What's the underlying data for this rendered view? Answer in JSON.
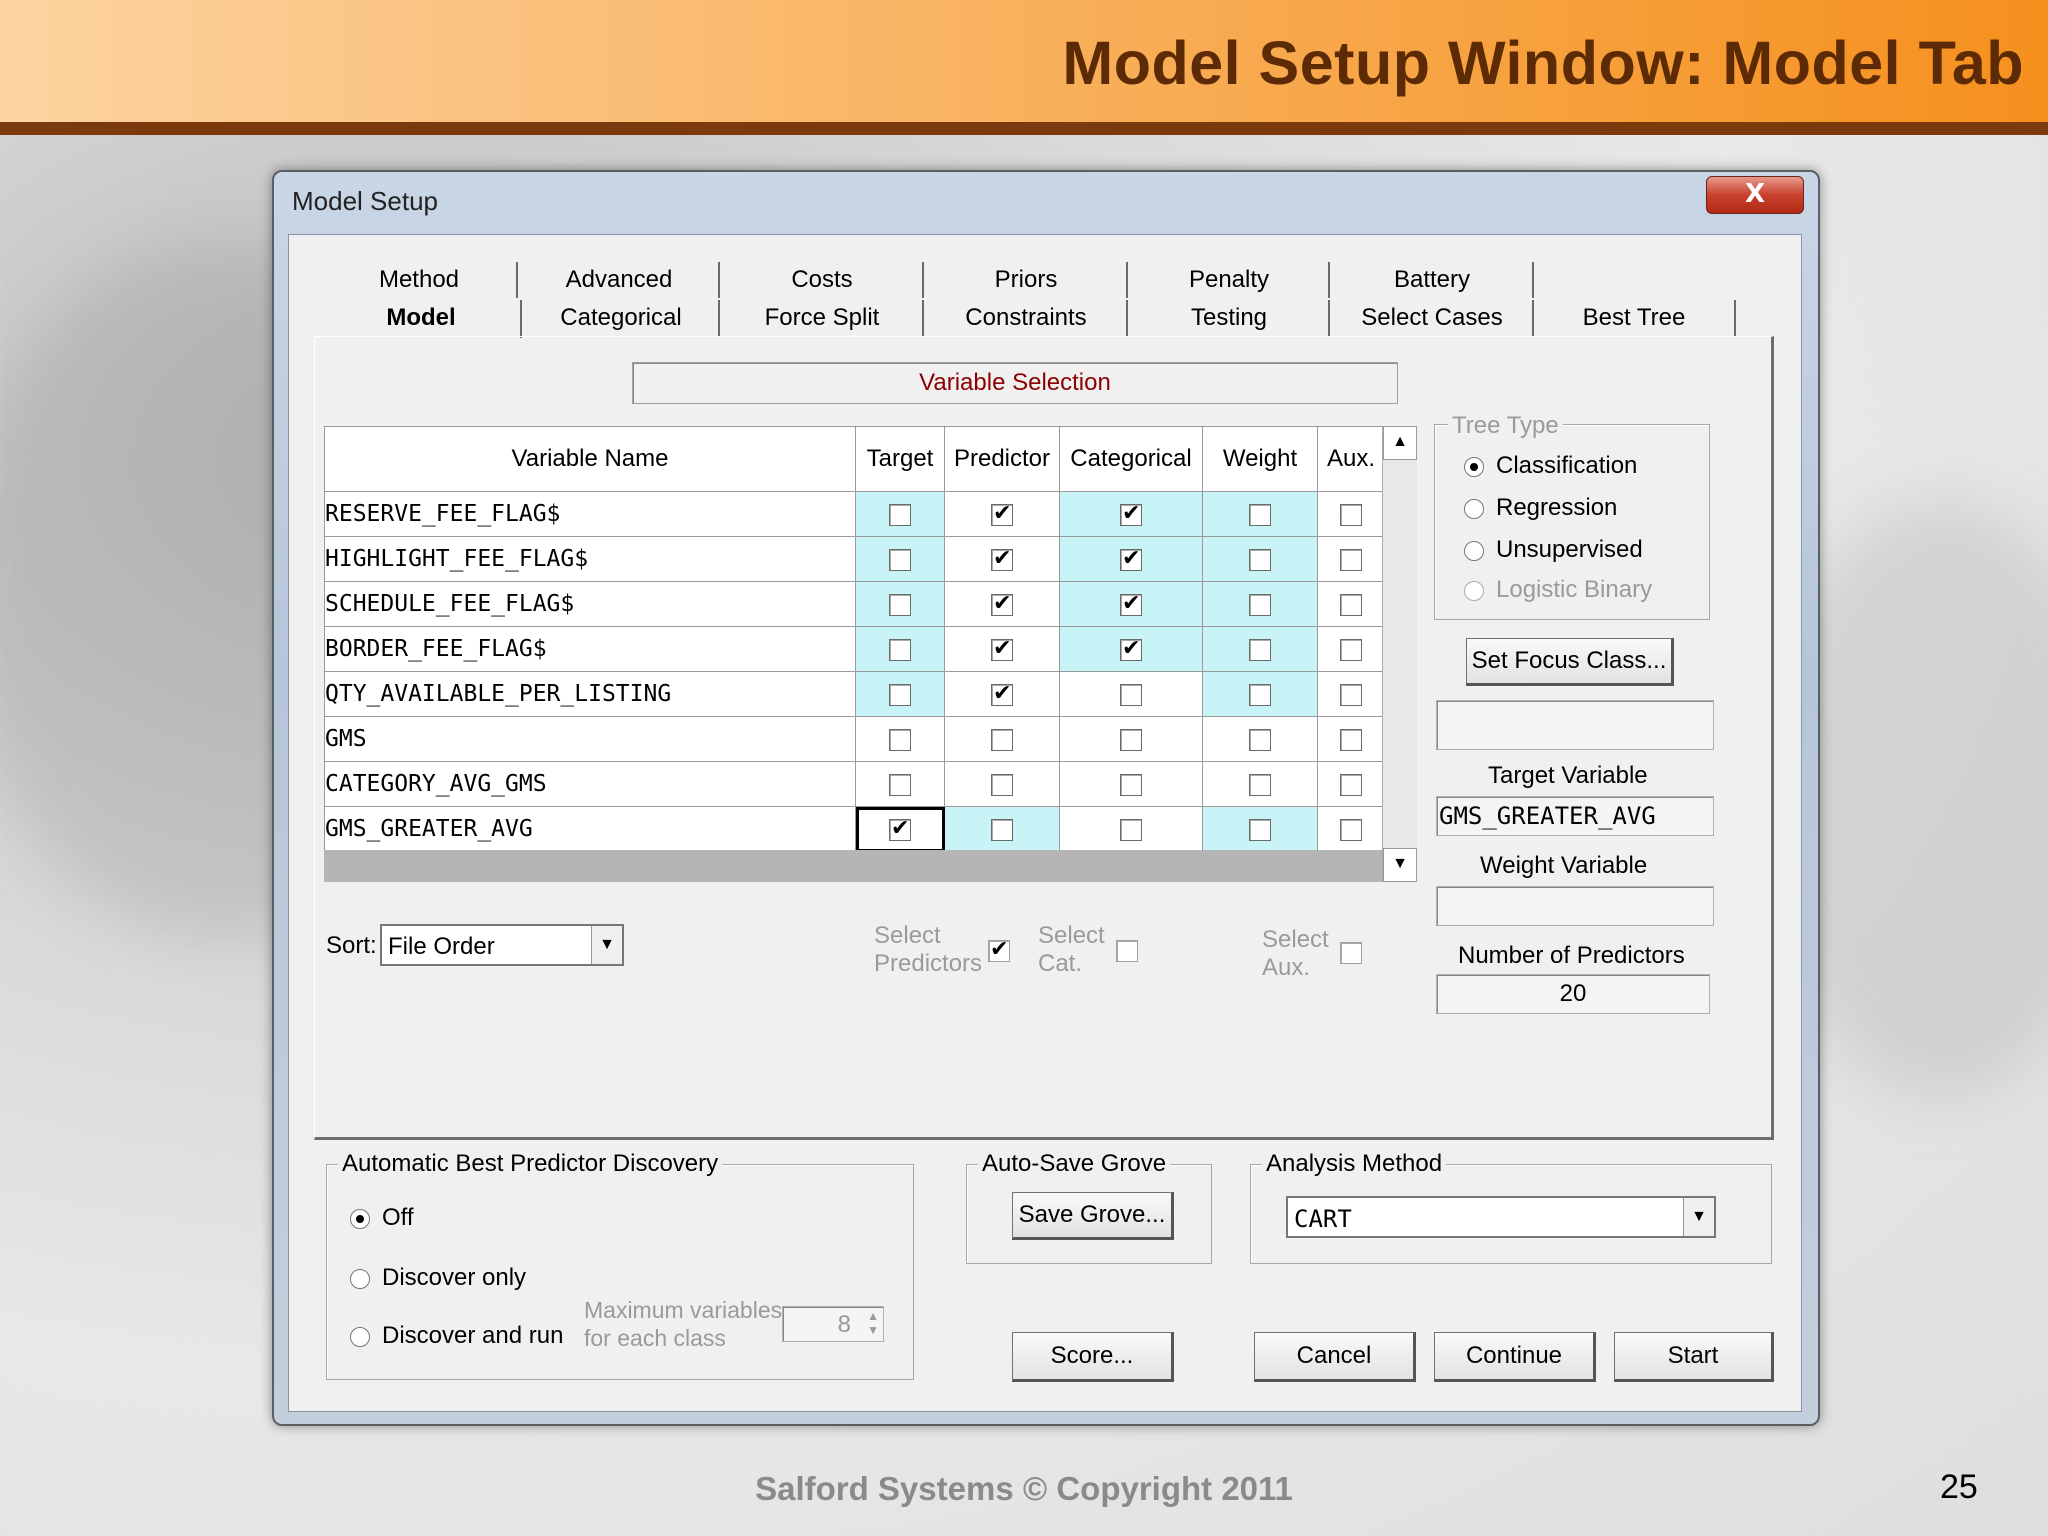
{
  "slide": {
    "title": "Model Setup Window: Model Tab",
    "footer": "Salford Systems   © Copyright 2011",
    "page_number": "25"
  },
  "window": {
    "title": "Model Setup",
    "close_label": "X"
  },
  "tabs_row1": [
    "Method",
    "Advanced",
    "Costs",
    "Priors",
    "Penalty",
    "Battery"
  ],
  "tabs_row2": [
    "Model",
    "Categorical",
    "Force Split",
    "Constraints",
    "Testing",
    "Select Cases",
    "Best Tree"
  ],
  "active_tab": "Model",
  "variable_selection_label": "Variable Selection",
  "grid": {
    "columns": [
      "Variable Name",
      "Target",
      "Predictor",
      "Categorical",
      "Weight",
      "Aux."
    ],
    "rows": [
      {
        "name": "RESERVE_FEE_FLAG$",
        "target": false,
        "predictor": true,
        "categorical": true,
        "weight": false,
        "aux": false
      },
      {
        "name": "HIGHLIGHT_FEE_FLAG$",
        "target": false,
        "predictor": true,
        "categorical": true,
        "weight": false,
        "aux": false
      },
      {
        "name": "SCHEDULE_FEE_FLAG$",
        "target": false,
        "predictor": true,
        "categorical": true,
        "weight": false,
        "aux": false
      },
      {
        "name": "BORDER_FEE_FLAG$",
        "target": false,
        "predictor": true,
        "categorical": true,
        "weight": false,
        "aux": false
      },
      {
        "name": "QTY_AVAILABLE_PER_LISTING",
        "target": false,
        "predictor": true,
        "categorical": false,
        "weight": false,
        "aux": false
      },
      {
        "name": "GMS",
        "target": false,
        "predictor": false,
        "categorical": false,
        "weight": false,
        "aux": false
      },
      {
        "name": "CATEGORY_AVG_GMS",
        "target": false,
        "predictor": false,
        "categorical": false,
        "weight": false,
        "aux": false
      },
      {
        "name": "GMS_GREATER_AVG",
        "target": true,
        "predictor": false,
        "categorical": false,
        "weight": false,
        "aux": false
      }
    ]
  },
  "sort": {
    "label": "Sort:",
    "value": "File Order"
  },
  "select_predictors": {
    "line1": "Select",
    "line2": "Predictors",
    "checked": true
  },
  "select_cat": {
    "line1": "Select",
    "line2": "Cat.",
    "checked": false
  },
  "select_aux": {
    "line1": "Select",
    "line2": "Aux.",
    "checked": false
  },
  "tree_type": {
    "title": "Tree Type",
    "options": [
      "Classification",
      "Regression",
      "Unsupervised",
      "Logistic Binary"
    ],
    "selected": "Classification"
  },
  "set_focus_class_label": "Set Focus Class...",
  "focus_class_value": "",
  "target_variable": {
    "label": "Target Variable",
    "value": "GMS_GREATER_AVG"
  },
  "weight_variable": {
    "label": "Weight Variable",
    "value": ""
  },
  "number_of_predictors": {
    "label": "Number of Predictors",
    "value": "20"
  },
  "best_predictor": {
    "title": "Automatic Best Predictor Discovery",
    "options": [
      "Off",
      "Discover only",
      "Discover and run"
    ],
    "selected": "Off",
    "max_vars_line1": "Maximum variables",
    "max_vars_line2": "for each class",
    "max_vars_value": "8"
  },
  "auto_save": {
    "title": "Auto-Save Grove",
    "button": "Save Grove..."
  },
  "analysis_method": {
    "title": "Analysis Method",
    "value": "CART"
  },
  "buttons": {
    "score": "Score...",
    "cancel": "Cancel",
    "continue": "Continue",
    "start": "Start"
  }
}
